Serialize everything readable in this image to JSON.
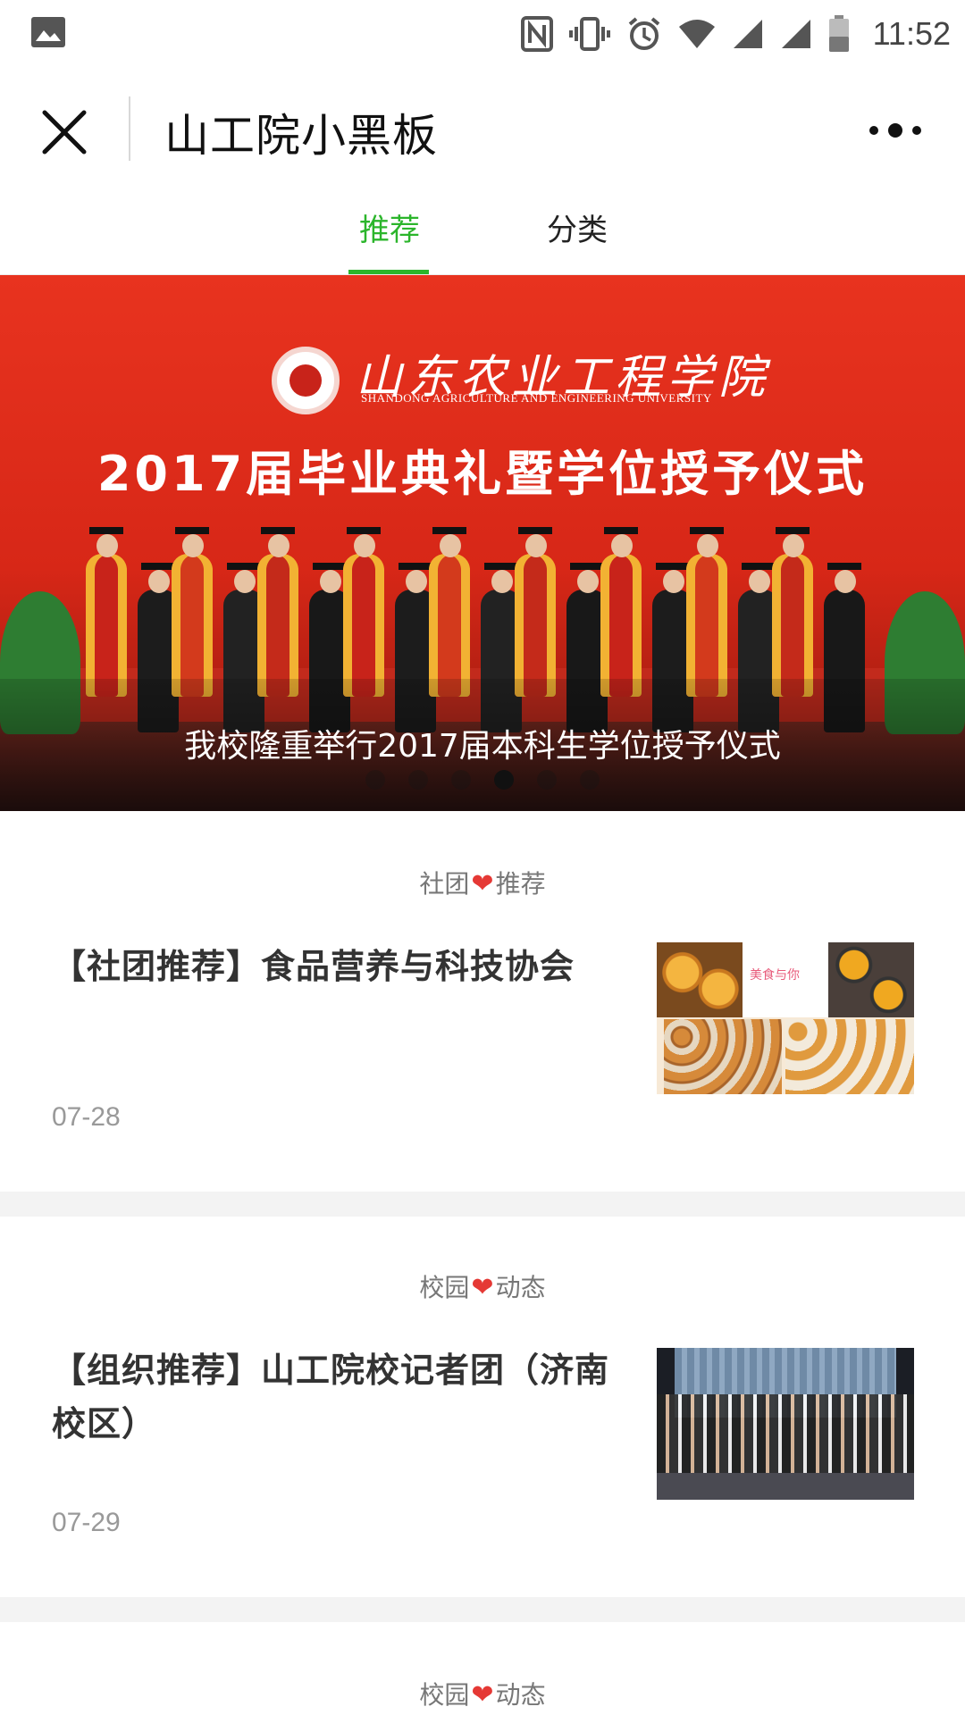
{
  "status_bar": {
    "time": "11:52",
    "icons": [
      "gallery-icon",
      "nfc-icon",
      "vibrate-icon",
      "alarm-icon",
      "wifi-icon",
      "signal-icon",
      "signal-icon",
      "battery-icon"
    ]
  },
  "title_bar": {
    "title": "山工院小黑板",
    "close_icon": "close-icon",
    "more_icon": "more-icon"
  },
  "tabs": [
    {
      "label": "推荐",
      "active": true
    },
    {
      "label": "分类",
      "active": false
    }
  ],
  "banner": {
    "school_name": "山东农业工程学院",
    "school_name_en": "SHANDONG AGRICULTURE AND ENGINEERING UNIVERSITY",
    "ceremony_title": "2017届毕业典礼暨学位授予仪式",
    "caption": "我校隆重举行2017届本科生学位授予仪式",
    "slide_count": 6,
    "active_slide": 4
  },
  "articles": [
    {
      "category_left": "社团",
      "category_right": "推荐",
      "title": "【社团推荐】食品营养与科技协会",
      "date": "07-28",
      "thumb_text": "美食与你"
    },
    {
      "category_left": "校园",
      "category_right": "动态",
      "title": "【组织推荐】山工院校记者团（济南校区）",
      "date": "07-29"
    },
    {
      "category_left": "校园",
      "category_right": "动态"
    }
  ],
  "colors": {
    "accent": "#2bb52b",
    "heart": "#e53935",
    "banner_red": "#d72717"
  }
}
